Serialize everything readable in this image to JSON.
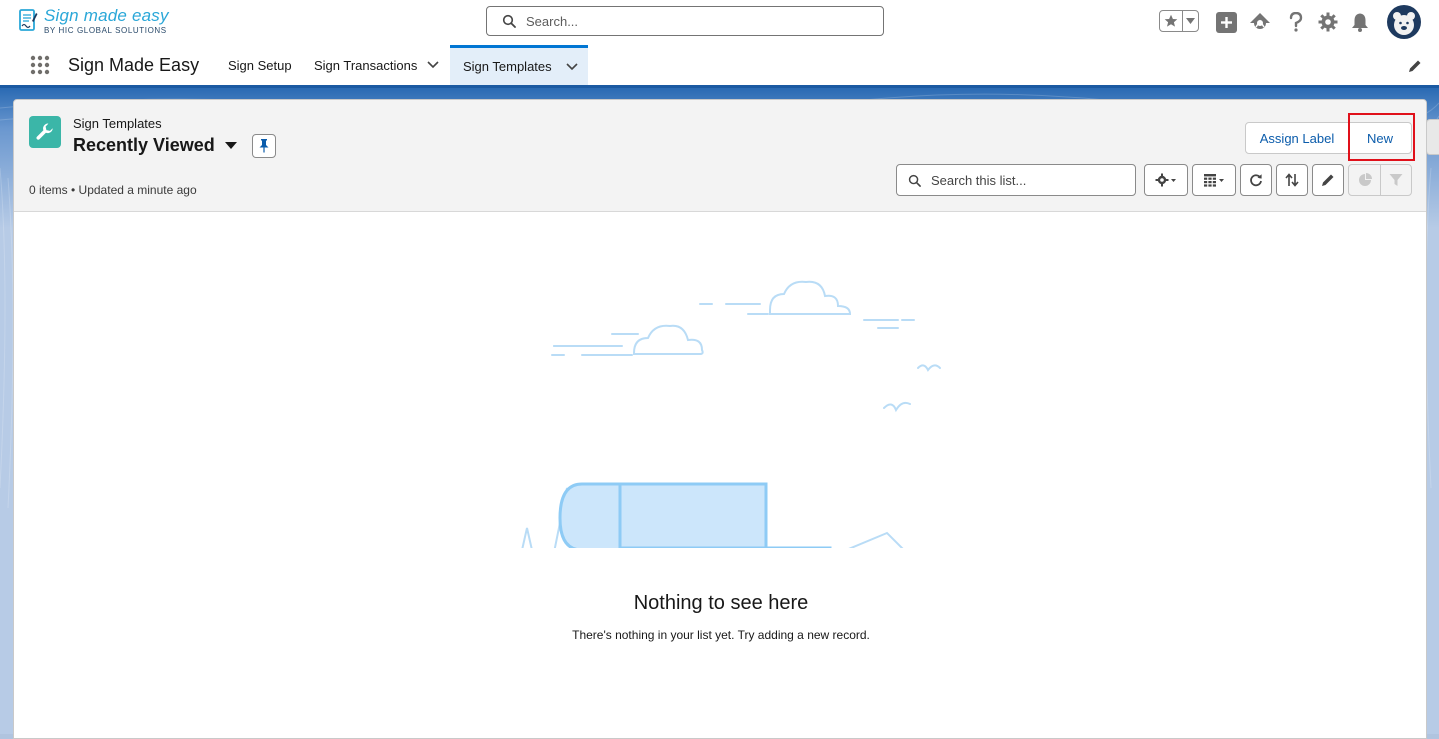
{
  "brand": {
    "title": "Sign made easy",
    "subtitle": "BY HIC GLOBAL SOLUTIONS"
  },
  "global_search": {
    "placeholder": "Search..."
  },
  "header_icons": [
    "favorites-star-icon",
    "favorites-menu-icon",
    "add-icon",
    "trailhead-icon",
    "help-icon",
    "setup-gear-icon",
    "notifications-bell-icon",
    "user-avatar"
  ],
  "nav": {
    "app_name": "Sign Made Easy",
    "tabs": [
      {
        "label": "Sign Setup",
        "has_menu": false,
        "active": false
      },
      {
        "label": "Sign Transactions",
        "has_menu": true,
        "active": false
      },
      {
        "label": "Sign Templates",
        "has_menu": true,
        "active": true
      }
    ]
  },
  "list_view": {
    "object_label": "Sign Templates",
    "title": "Recently Viewed",
    "meta": "0 items • Updated a minute ago",
    "buttons": {
      "assign_label": "Assign Label",
      "new": "New"
    },
    "search_placeholder": "Search this list...",
    "tools": [
      "list-settings-icon",
      "display-as-table-icon",
      "refresh-icon",
      "sort-icon",
      "edit-list-icon",
      "charts-icon",
      "filter-icon"
    ]
  },
  "empty_state": {
    "title": "Nothing to see here",
    "body": "There's nothing in your list yet. Try adding a new record."
  },
  "colors": {
    "brand_blue": "#0176d3",
    "link_blue": "#0b5cab",
    "object_icon_teal": "#3bb6a8",
    "highlight_red": "#e0101a",
    "illustration_blue": "#8ecbf5",
    "illustration_fill": "#cce6fb"
  }
}
